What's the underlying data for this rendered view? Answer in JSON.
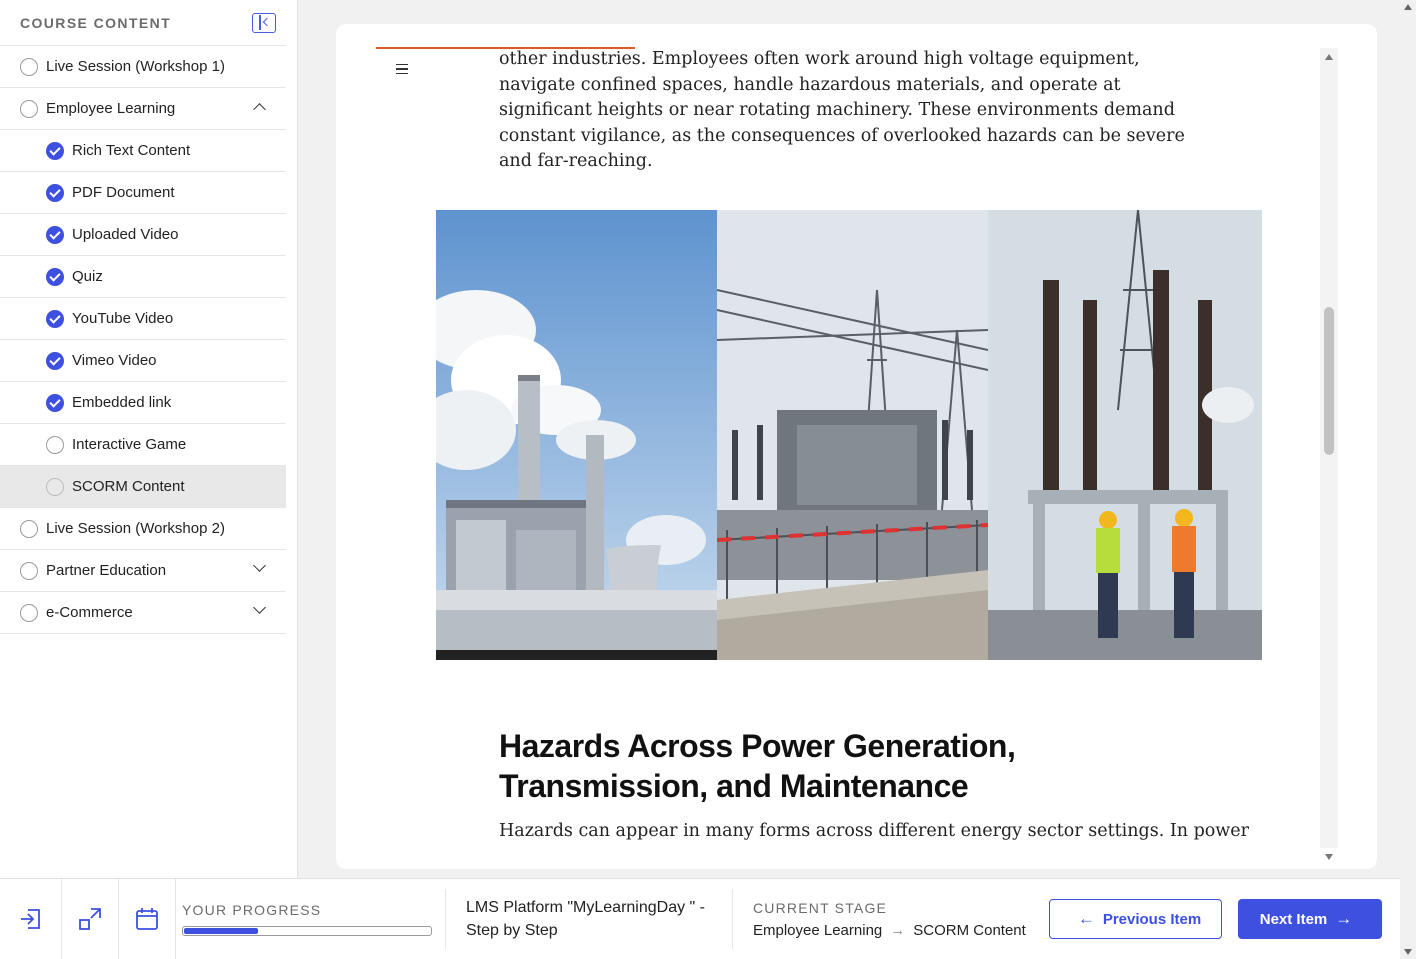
{
  "sidebar": {
    "title": "COURSE CONTENT",
    "items": [
      {
        "label": "Live Session (Workshop 1)",
        "state": "incomplete"
      },
      {
        "label": "Employee Learning",
        "state": "incomplete",
        "expanded": true
      },
      {
        "label": "Rich Text Content",
        "state": "complete"
      },
      {
        "label": "PDF Document",
        "state": "complete"
      },
      {
        "label": "Uploaded Video",
        "state": "complete"
      },
      {
        "label": "Quiz",
        "state": "complete"
      },
      {
        "label": "YouTube Video",
        "state": "complete"
      },
      {
        "label": "Vimeo Video",
        "state": "complete"
      },
      {
        "label": "Embedded link",
        "state": "complete"
      },
      {
        "label": "Interactive Game",
        "state": "incomplete"
      },
      {
        "label": "SCORM Content",
        "state": "incomplete",
        "active": true
      },
      {
        "label": "Live Session (Workshop 2)",
        "state": "incomplete"
      },
      {
        "label": "Partner Education",
        "state": "incomplete",
        "expanded": false
      },
      {
        "label": "e-Commerce",
        "state": "incomplete",
        "expanded": false
      }
    ]
  },
  "content": {
    "paragraph1": "other industries. Employees often work around high voltage equipment, navigate confined spaces, handle hazardous materials, and operate at significant heights or near rotating machinery. These environments demand constant vigilance, as the consequences of overlooked hazards can be severe and far-reaching.",
    "heading": "Hazards Across Power Generation, Transmission, and Maintenance",
    "paragraph2": "Hazards can appear in many forms across different energy sector settings. In power"
  },
  "bottombar": {
    "progress_label": "YOUR PROGRESS",
    "progress_fraction": 0.3,
    "course_title": "LMS Platform \"MyLearningDay \" - Step by Step",
    "stage_label": "CURRENT STAGE",
    "stage_from": "Employee Learning",
    "stage_to": "SCORM Content",
    "prev_label": "Previous Item",
    "next_label": "Next Item"
  },
  "colors": {
    "accent": "#3d50e0",
    "highlight_line": "#e0592a"
  }
}
